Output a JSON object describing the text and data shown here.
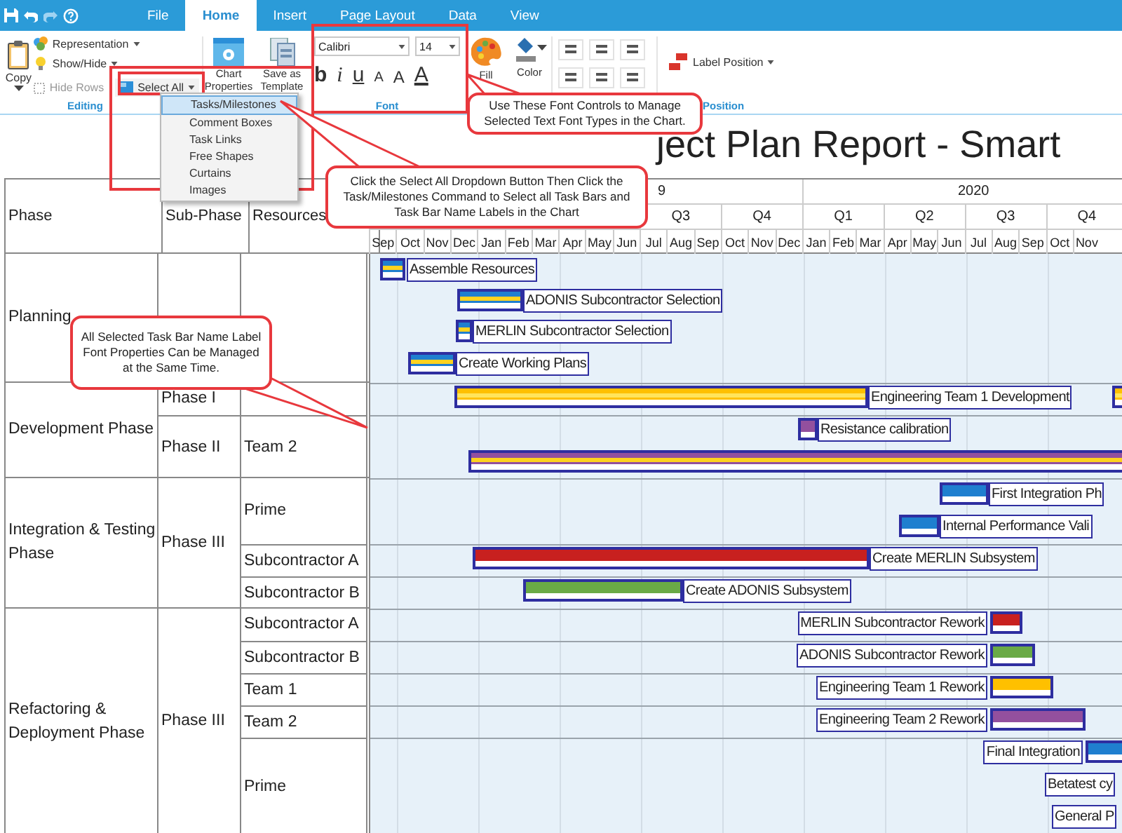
{
  "tabs": [
    {
      "label": "File",
      "selected": false
    },
    {
      "label": "Home",
      "selected": true
    },
    {
      "label": "Insert",
      "selected": false
    },
    {
      "label": "Page Layout",
      "selected": false
    },
    {
      "label": "Data",
      "selected": false
    },
    {
      "label": "View",
      "selected": false
    }
  ],
  "ribbon": {
    "copy": "Copy",
    "representation": "Representation",
    "show_hide": "Show/Hide",
    "hide_rows": {
      "label": "Hide Rows",
      "disabled": true
    },
    "select_all": "Select All",
    "chart_properties": "Chart Properties",
    "save_template": "Save as Template",
    "editing_label": "Editing",
    "font_family": "Calibri",
    "font_size": "14",
    "font_buttons": [
      {
        "glyph": "b",
        "kind": "bold"
      },
      {
        "glyph": "i",
        "kind": "italic"
      },
      {
        "glyph": "u",
        "kind": "underline"
      },
      {
        "glyph": "A",
        "kind": "shrink"
      },
      {
        "glyph": "A",
        "kind": "grow"
      },
      {
        "glyph": "A",
        "kind": "color"
      }
    ],
    "font_label": "Font",
    "fill": "Fill",
    "color_button": "Color",
    "label_position": "Label Position",
    "position_label": "Position"
  },
  "select_menu": [
    {
      "label": "Tasks/Milestones",
      "selected": true
    },
    {
      "label": "Comment Boxes",
      "selected": false
    },
    {
      "label": "Task Links",
      "selected": false
    },
    {
      "label": "Free Shapes",
      "selected": false
    },
    {
      "label": "Curtains",
      "selected": false
    },
    {
      "label": "Images",
      "selected": false
    }
  ],
  "report_title": "ject Plan Report - Smart",
  "table": {
    "columns": [
      "Phase",
      "Sub-Phase",
      "Resources"
    ],
    "years": [
      "9",
      "2020"
    ],
    "quarters": [
      "Q3",
      "Q4",
      "Q1",
      "Q2",
      "Q3",
      "Q4"
    ],
    "months": [
      "Sep",
      "Oct",
      "Nov",
      "Dec",
      "Jan",
      "Feb",
      "Mar",
      "Apr",
      "May",
      "Jun",
      "Jul",
      "Aug",
      "Sep",
      "Oct",
      "Nov",
      "Dec",
      "Jan",
      "Feb",
      "Mar",
      "Apr",
      "May",
      "Jun",
      "Jul",
      "Aug",
      "Sep",
      "Oct",
      "Nov"
    ],
    "phases": [
      {
        "name": "Planning"
      },
      {
        "name": "Development Phase",
        "subphases": [
          {
            "name": "Phase I"
          },
          {
            "name": "Phase II",
            "resources": [
              {
                "name": "Team 2"
              }
            ]
          }
        ]
      },
      {
        "name": "Integration & Testing Phase",
        "subphases": [
          {
            "name": "Phase III",
            "resources": [
              {
                "name": "Prime"
              },
              {
                "name": "Subcontractor A"
              },
              {
                "name": "Subcontractor B"
              }
            ]
          }
        ]
      },
      {
        "name": "Refactoring & Deployment Phase",
        "subphases": [
          {
            "name": "Phase III",
            "resources": [
              {
                "name": "Subcontractor A"
              },
              {
                "name": "Subcontractor B"
              },
              {
                "name": "Team 1"
              },
              {
                "name": "Team 2"
              },
              {
                "name": "Prime"
              }
            ]
          }
        ]
      }
    ]
  },
  "tasks": [
    {
      "name": "Assemble Resources",
      "color": "#1f7fcf",
      "stripe": true
    },
    {
      "name": "ADONIS Subcontractor Selection",
      "color": "#1f7fcf",
      "stripe": true
    },
    {
      "name": "MERLIN Subcontractor Selection",
      "color": "#1f7fcf",
      "stripe": true
    },
    {
      "name": "Create Working Plans",
      "color": "#1f7fcf",
      "stripe": true
    },
    {
      "name": "Engineering Team 1 Development",
      "color": "#ffc000",
      "stripe": true
    },
    {
      "name": "Resistance calibration",
      "color": "#93509e",
      "stripe": false
    },
    {
      "color": "#93509e",
      "stripe": true
    },
    {
      "name": "First Integration Ph",
      "color": "#1f7fcf",
      "stripe": false
    },
    {
      "name": "Internal Performance Vali",
      "color": "#1f7fcf",
      "stripe": false
    },
    {
      "name": "Create MERLIN Subsystem",
      "color": "#c8201f",
      "stripe": false
    },
    {
      "name": "Create ADONIS Subsystem",
      "color": "#6aaa46",
      "stripe": false
    },
    {
      "name": "MERLIN Subcontractor Rework",
      "color": "#c8201f",
      "stripe": false
    },
    {
      "name": "ADONIS Subcontractor Rework",
      "color": "#6aaa46",
      "stripe": false
    },
    {
      "name": "Engineering Team 1 Rework",
      "color": "#ffc000",
      "stripe": false
    },
    {
      "name": "Engineering Team 2 Rework",
      "color": "#93509e",
      "stripe": false
    },
    {
      "name": "Final Integration",
      "color": "#1f7fcf",
      "stripe": false
    },
    {
      "name": "Betatest cy"
    },
    {
      "name": "General P"
    }
  ],
  "callouts": [
    {
      "text": "Use These Font Controls to Manage Selected Text Font Types in the Chart."
    },
    {
      "text": "Click the Select All Dropdown Button Then Click the Task/Milestones Command to Select all Task Bars and Task Bar Name Labels in the Chart"
    },
    {
      "text": "All Selected Task Bar Name Label Font Properties Can be Managed at the Same Time."
    }
  ]
}
